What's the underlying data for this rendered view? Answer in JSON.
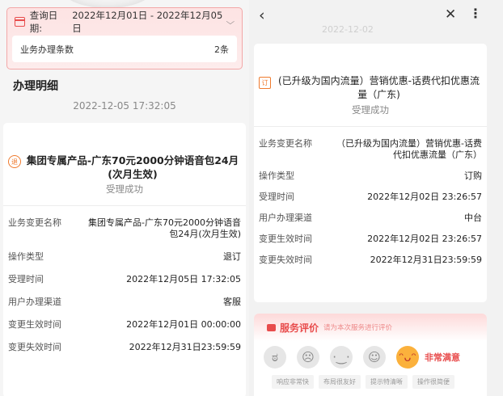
{
  "left": {
    "query": {
      "label": "查询日期:",
      "range": "2022年12月01日 - 2022年12月05日"
    },
    "count": {
      "label": "业务办理条数",
      "value": "2条"
    },
    "section_title": "办理明细",
    "timestamp": "2022-12-05 17:32:05",
    "detail": {
      "title": "集团专属产品-广东70元2000分钟语音包24月(次月生效)",
      "status": "受理成功",
      "rows": [
        {
          "k": "业务变更名称",
          "v": "集团专属产品-广东70元2000分钟语音包24月(次月生效)"
        },
        {
          "k": "操作类型",
          "v": "退订"
        },
        {
          "k": "受理时间",
          "v": "2022年12月05日 17:32:05"
        },
        {
          "k": "用户办理渠道",
          "v": "客服"
        },
        {
          "k": "变更生效时间",
          "v": "2022年12月01日 00:00:00"
        },
        {
          "k": "变更失效时间",
          "v": "2022年12月31日23:59:59"
        }
      ]
    }
  },
  "right": {
    "ghost_text": "2022-12-02",
    "detail": {
      "title": "(已升级为国内流量）营销优惠-话费代扣优惠流量（广东)",
      "status": "受理成功",
      "rows": [
        {
          "k": "业务变更名称",
          "v": "（已升级为国内流量）营销优惠-话费代扣优惠流量（广东）"
        },
        {
          "k": "操作类型",
          "v": "订购"
        },
        {
          "k": "受理时间",
          "v": "2022年12月02日 23:26:57"
        },
        {
          "k": "用户办理渠道",
          "v": "中台"
        },
        {
          "k": "变更生效时间",
          "v": "2022年12月02日 23:26:57"
        },
        {
          "k": "变更失效时间",
          "v": "2022年12月31日23:59:59"
        }
      ]
    },
    "evaluation": {
      "title": "服务评价",
      "subtitle": "请为本次服务进行评价",
      "very_satisfied": "非常满意",
      "tags": [
        "响应非常快",
        "布局很友好",
        "提示特清晰",
        "操作很简便"
      ]
    }
  },
  "colors": {
    "accent": "#e84c4c",
    "icon_orange": "#ef7a2e"
  }
}
